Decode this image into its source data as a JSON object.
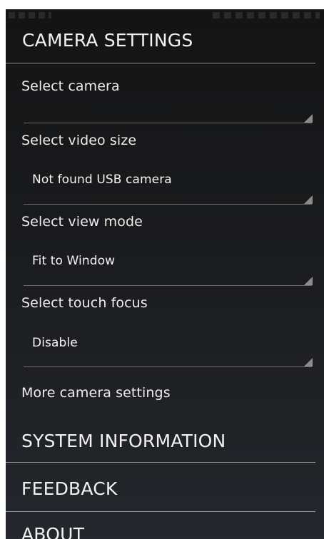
{
  "camera_settings": {
    "title": "CAMERA SETTINGS",
    "select_camera": {
      "label": "Select camera",
      "value": ""
    },
    "select_video_size": {
      "label": "Select video size",
      "value": "Not found USB camera"
    },
    "select_view_mode": {
      "label": "Select view mode",
      "value": "Fit to Window"
    },
    "select_touch_focus": {
      "label": "Select touch focus",
      "value": "Disable"
    },
    "more_settings": {
      "label": "More camera settings"
    }
  },
  "system_information": {
    "title": "SYSTEM INFORMATION"
  },
  "feedback": {
    "title": "FEEDBACK"
  },
  "about": {
    "title": "ABOUT"
  }
}
